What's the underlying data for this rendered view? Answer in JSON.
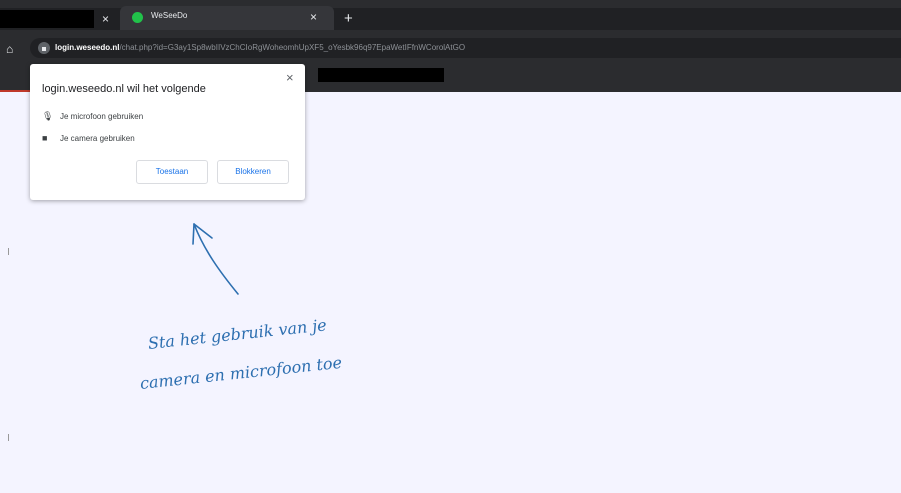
{
  "browser": {
    "tab": {
      "title": "WeSeeDo"
    },
    "tab_close_glyph": "×",
    "new_tab_glyph": "+",
    "address": {
      "host": "login.weseedo.nl",
      "path": "/chat.php?id=G3ay1Sp8wbIIVzChCIoRgWoheomhUpXF5_oYesbk96q97EpaWetIFfnWCorolAtGO"
    }
  },
  "permission_prompt": {
    "title": "login.weseedo.nl wil het volgende",
    "close_glyph": "×",
    "permissions": [
      {
        "label": "Je microfoon gebruiken",
        "icon": "microphone-icon",
        "glyph": "🎙"
      },
      {
        "label": "Je camera gebruiken",
        "icon": "camera-icon",
        "glyph": "■"
      }
    ],
    "allow_label": "Toestaan",
    "block_label": "Blokkeren"
  },
  "annotation": {
    "line1": "Sta het gebruik van je",
    "line2": "camera en microfoon toe",
    "color": "#2d6fb0"
  },
  "colors": {
    "chrome_dark": "#2b2c2f",
    "page_bg": "#f4f4ff",
    "link_blue": "#1a73e8",
    "favicon_green": "#21c24a"
  }
}
